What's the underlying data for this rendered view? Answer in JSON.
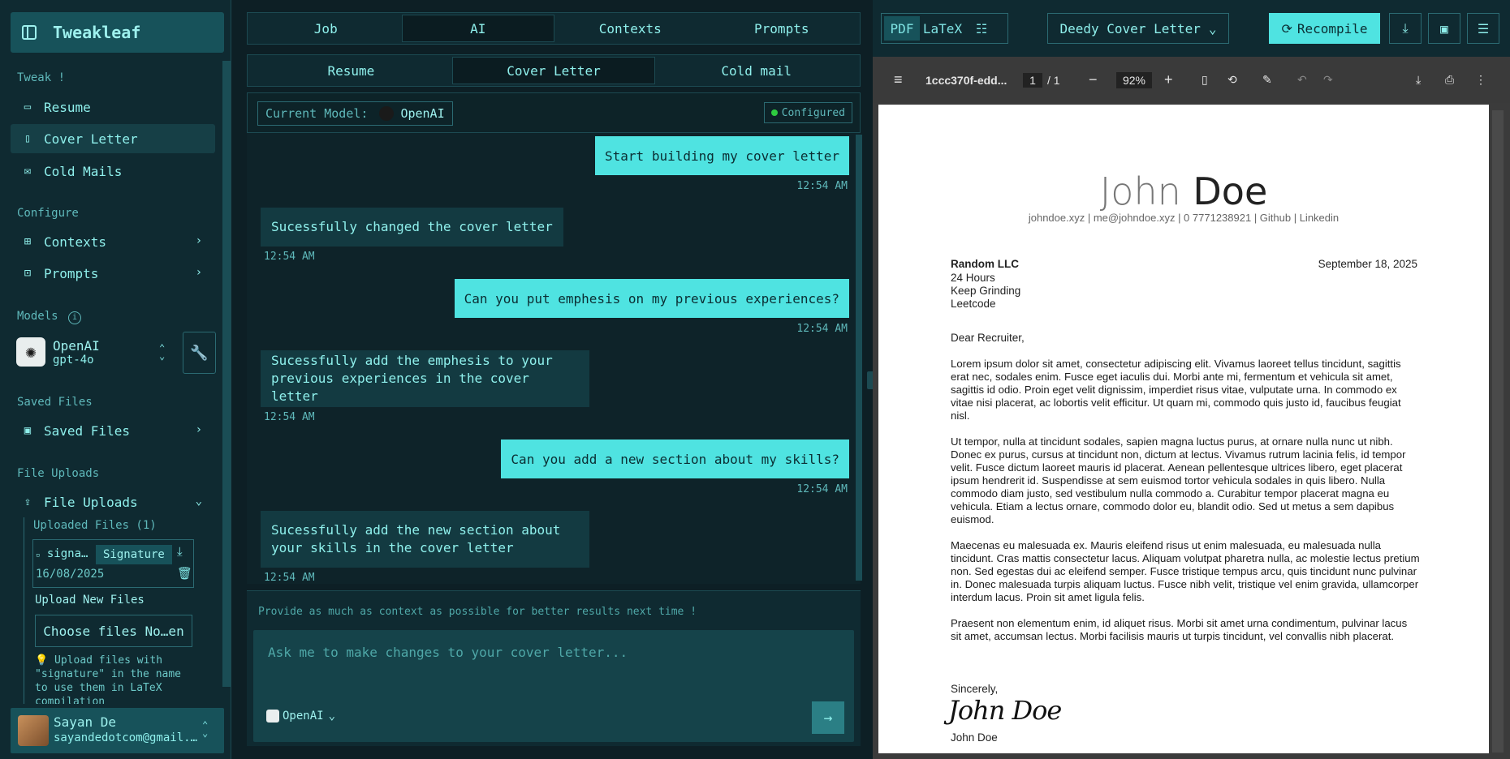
{
  "app": {
    "title": "Tweakleaf"
  },
  "sidebar": {
    "sections": {
      "tweak": "Tweak !",
      "configure": "Configure",
      "models": "Models",
      "saved": "Saved Files",
      "uploads": "File Uploads"
    },
    "tweak_items": [
      {
        "label": "Resume",
        "icon": "briefcase-icon"
      },
      {
        "label": "Cover Letter",
        "icon": "document-icon"
      },
      {
        "label": "Cold Mails",
        "icon": "mail-icon"
      }
    ],
    "configure_items": [
      {
        "label": "Contexts",
        "icon": "contexts-icon"
      },
      {
        "label": "Prompts",
        "icon": "terminal-icon"
      }
    ],
    "model": {
      "provider": "OpenAI",
      "name": "gpt-4o"
    },
    "saved_files_label": "Saved Files",
    "file_uploads_label": "File Uploads",
    "uploaded_header": "Uploaded Files (1)",
    "uploaded_file": {
      "name": "signa…",
      "tag": "Signature",
      "date": "16/08/2025"
    },
    "upload_new_label": "Upload New Files",
    "choose_files": "Choose files",
    "choose_status": "No…en",
    "hint": "💡 Upload files with \"signature\" in the name to use them in LaTeX compilation",
    "user": {
      "name": "Sayan De",
      "email": "sayandedotcom@gmail.…"
    }
  },
  "chat": {
    "tabs": [
      "Job",
      "AI",
      "Contexts",
      "Prompts"
    ],
    "subtabs": [
      "Resume",
      "Cover Letter",
      "Cold mail"
    ],
    "current_model_label": "Current Model:",
    "current_model": "OpenAI",
    "status": "Configured",
    "messages": [
      {
        "role": "user",
        "text": "Start building my cover letter",
        "time": "12:54 AM"
      },
      {
        "role": "ai",
        "text": "Sucessfully changed the cover letter",
        "time": "12:54 AM"
      },
      {
        "role": "user",
        "text": "Can you put emphesis on my previous experiences?",
        "time": "12:54 AM"
      },
      {
        "role": "ai",
        "text": "Sucessfully add the emphesis to your previous experiences in the cover letter",
        "time": "12:54 AM"
      },
      {
        "role": "user",
        "text": "Can you add a new section about my skills?",
        "time": "12:54 AM"
      },
      {
        "role": "ai",
        "text": "Sucessfully add the new section about your skills in the cover letter",
        "time": "12:54 AM"
      }
    ],
    "context_hint": "Provide as much as context as possible for better results next time !",
    "input_placeholder": "Ask me to make changes to your cover letter...",
    "input_model": "OpenAI"
  },
  "pdf": {
    "toggle": [
      "PDF",
      "LaTeX"
    ],
    "template": "Deedy Cover Letter",
    "recompile": "Recompile",
    "viewer": {
      "filename": "1ccc370f-edd...",
      "page": "1",
      "total": "/ 1",
      "zoom": "92%"
    },
    "doc": {
      "first_name": "John",
      "last_name": "Doe",
      "contact": "johndoe.xyz | me@johndoe.xyz | 0 7771238921 | Github | Linkedin",
      "company": "Random LLC",
      "addr1": "24 Hours",
      "addr2": "Keep Grinding",
      "addr3": "Leetcode",
      "date": "September 18, 2025",
      "greeting": "Dear Recruiter,",
      "p1": "Lorem ipsum dolor sit amet, consectetur adipiscing elit. Vivamus laoreet tellus tincidunt, sagittis erat nec, sodales enim. Fusce eget iaculis dui. Morbi ante mi, fermentum et vehicula sit amet, sagittis id odio. Proin eget velit dignissim, imperdiet risus vitae, vulputate urna. In commodo ex vitae nisi placerat, ac lobortis velit efficitur. Ut quam mi, commodo quis justo id, faucibus feugiat nisl.",
      "p2": "Ut tempor, nulla at tincidunt sodales, sapien magna luctus purus, at ornare nulla nunc ut nibh. Donec ex purus, cursus at tincidunt non, dictum at lectus. Vivamus rutrum lacinia felis, id tempor velit. Fusce dictum laoreet mauris id placerat. Aenean pellentesque ultrices libero, eget placerat ipsum hendrerit id. Suspendisse at sem euismod tortor vehicula sodales in quis libero. Nulla commodo diam justo, sed vestibulum nulla commodo a. Curabitur tempor placerat magna eu vehicula. Etiam a lectus ornare, commodo dolor eu, blandit odio. Sed ut metus a sem dapibus euismod.",
      "p3": "Maecenas eu malesuada ex. Mauris eleifend risus ut enim malesuada, eu malesuada nulla tincidunt. Cras mattis consectetur lacus. Aliquam volutpat pharetra nulla, ac molestie lectus pretium non. Sed egestas dui ac eleifend semper. Fusce tristique tempus arcu, quis tincidunt nunc pulvinar in. Donec malesuada turpis aliquam luctus. Fusce nibh velit, tristique vel enim gravida, ullamcorper interdum lacus. Proin sit amet ligula felis.",
      "p4": "Praesent non elementum enim, id aliquet risus. Morbi sit amet urna condimentum, pulvinar lacus sit amet, accumsan lectus. Morbi facilisis mauris ut turpis tincidunt, vel convallis nibh placerat.",
      "closing": "Sincerely,",
      "signature": "John Doe",
      "signname": "John Doe"
    }
  },
  "colors": {
    "accent": "#4fe3e1",
    "bg": "#0d1f25",
    "panel": "#0f2a31",
    "ok": "#2ecc40"
  }
}
